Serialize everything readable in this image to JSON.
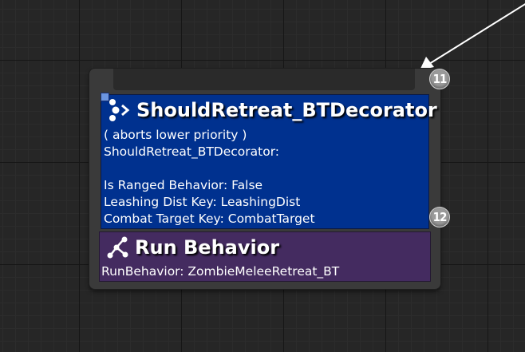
{
  "graph": {
    "node": {
      "decorator": {
        "title": "ShouldRetreat_BTDecorator",
        "abort_mode": "( aborts lower priority )",
        "class_name": "ShouldRetreat_BTDecorator:",
        "blank": "",
        "props": [
          "Is Ranged Behavior: False",
          "Leashing Dist Key: LeashingDist",
          "Combat Target Key: CombatTarget"
        ],
        "icon": "decorator-icon",
        "color": "#00318f"
      },
      "task": {
        "title": "Run Behavior",
        "desc": "RunBehavior: ZombieMeleeRetreat_BT",
        "icon": "run-behavior-icon",
        "color": "#442b60"
      },
      "execution_index_top": "11",
      "execution_index_bottom": "12"
    }
  }
}
